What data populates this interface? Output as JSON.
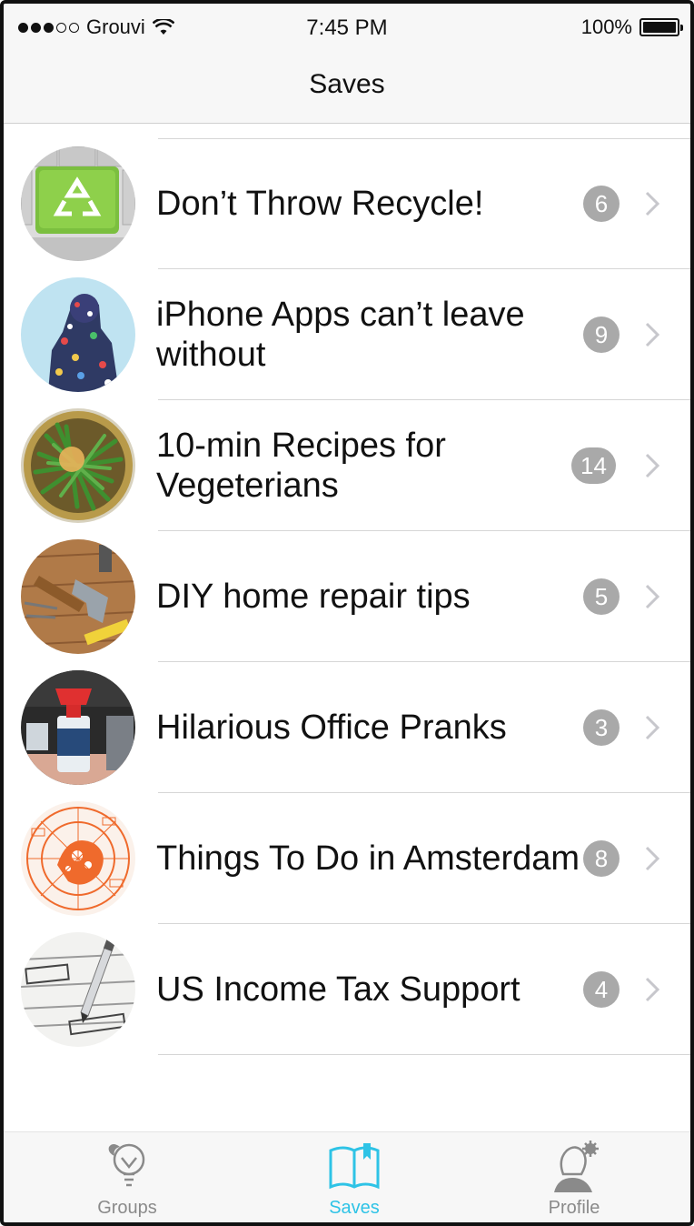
{
  "status_bar": {
    "carrier": "Grouvi",
    "time": "7:45 PM",
    "battery_percent": "100%",
    "signal_bars_filled": 3,
    "signal_bars_total": 5
  },
  "nav": {
    "title": "Saves"
  },
  "list": {
    "items": [
      {
        "title": "Don’t Throw Recycle!",
        "count": "6",
        "image": "recycle-key"
      },
      {
        "title": "iPhone Apps can’t leave without",
        "count": "9",
        "image": "app-figure"
      },
      {
        "title": "10-min Recipes for Vegeterians",
        "count": "14",
        "image": "green-beans-bowl"
      },
      {
        "title": "DIY home repair tips",
        "count": "5",
        "image": "hammer-tools"
      },
      {
        "title": "Hilarious Office Pranks",
        "count": "3",
        "image": "air-horn"
      },
      {
        "title": "Things To Do in Amsterdam",
        "count": "8",
        "image": "amsterdam-map"
      },
      {
        "title": "US Income Tax Support",
        "count": "4",
        "image": "tax-form-pen"
      }
    ]
  },
  "tabbar": {
    "tabs": [
      {
        "label": "Groups",
        "icon": "lightbulb-icon",
        "active": false
      },
      {
        "label": "Saves",
        "icon": "book-bookmark-icon",
        "active": true
      },
      {
        "label": "Profile",
        "icon": "profile-gear-icon",
        "active": false
      }
    ]
  },
  "colors": {
    "accent": "#2ec3e6",
    "badge": "#a9a9a9",
    "bar_background": "#f7f7f7"
  }
}
